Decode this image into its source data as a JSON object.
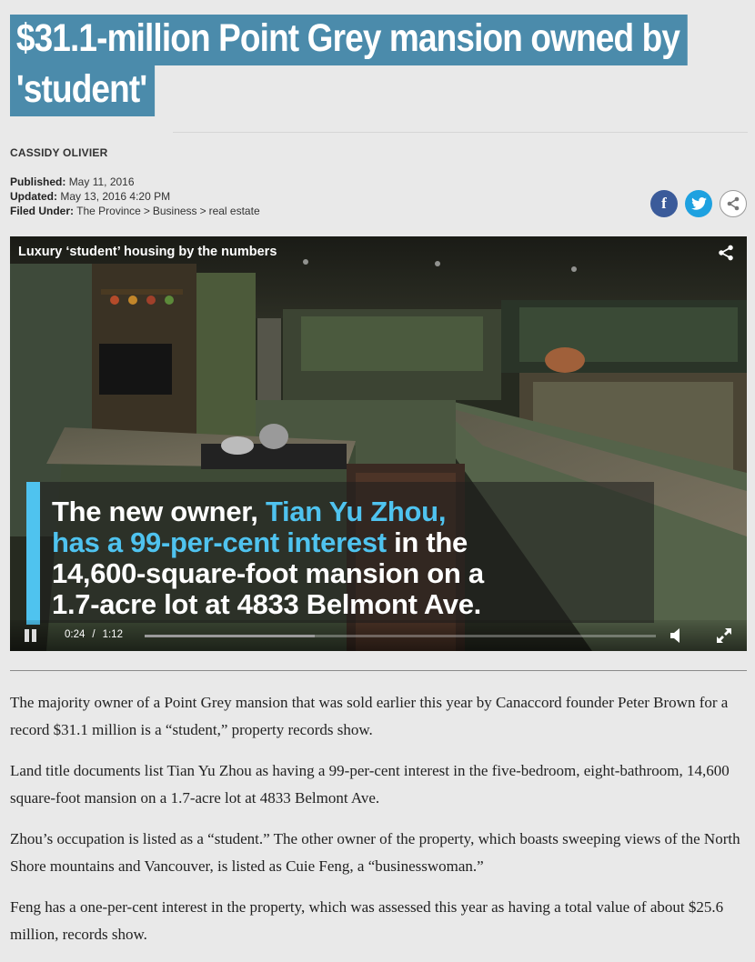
{
  "article": {
    "headline": "$31.1-million Point Grey mansion owned by 'student'",
    "author": "CASSIDY OLIVIER",
    "published_label": "Published:",
    "published_value": "May 11, 2016",
    "updated_label": "Updated:",
    "updated_value": "May 13, 2016 4:20 PM",
    "filed_label": "Filed Under:",
    "filed_items": [
      "The Province",
      "Business",
      "real estate"
    ],
    "filed_separator": ">"
  },
  "share": {
    "facebook_icon": "facebook-icon",
    "twitter_icon": "twitter-icon",
    "share_icon": "share-icon"
  },
  "video": {
    "title": "Luxury ‘student’ housing by the numbers",
    "caption_part1": "The new owner, ",
    "caption_highlight1": "Tian Yu Zhou,",
    "caption_highlight2": "has a 99-per-cent interest",
    "caption_part2": " in the",
    "caption_line3": "14,600-square-foot mansion on a",
    "caption_line4": "1.7-acre lot at 4833 Belmont Ave.",
    "current_time": "0:24",
    "time_separator": "/",
    "duration": "1:12",
    "progress_fraction": 0.333,
    "accent_color": "#4fc3ef"
  },
  "body": {
    "paragraphs": [
      "The majority owner of a Point Grey mansion that was sold earlier this year by Canaccord founder Peter Brown for a record $31.1 million is a “student,” property records show.",
      "Land title documents list Tian Yu Zhou as having a 99-per-cent interest in the five-bedroom, eight-bathroom, 14,600 square-foot mansion on a 1.7-acre lot at 4833 Belmont Ave.",
      "Zhou’s occupation is listed as a “student.” The other owner of the property, which boasts sweeping views of the North Shore mountains and Vancouver, is listed as Cuie Feng, a “businesswoman.”",
      "Feng has a one-per-cent interest in the property, which was assessed this year as having a total value of about $25.6 million, records show."
    ]
  },
  "colors": {
    "headline_bg": "#4b8bab",
    "facebook": "#3b5b9a",
    "twitter": "#1ea1e0"
  }
}
